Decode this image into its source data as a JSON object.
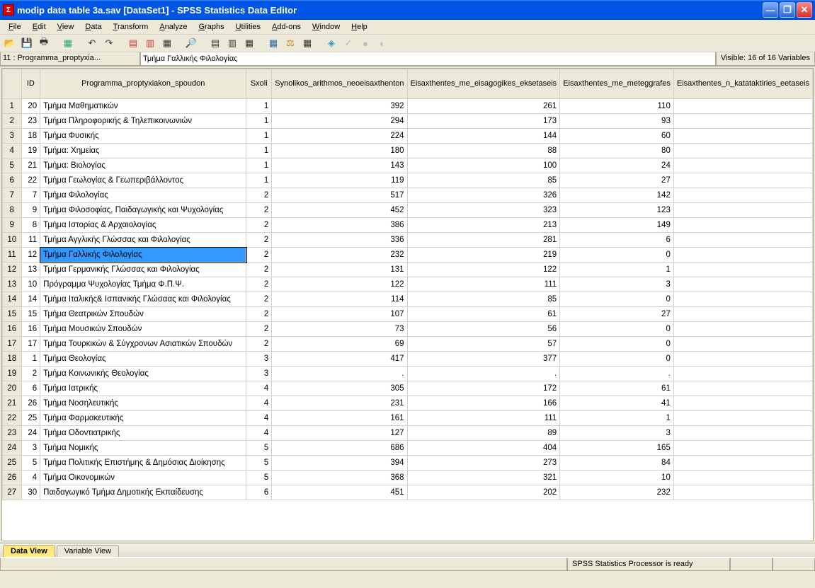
{
  "window": {
    "title": "modip data table 3a.sav [DataSet1] - SPSS Statistics Data Editor"
  },
  "menu": {
    "items": [
      "File",
      "Edit",
      "View",
      "Data",
      "Transform",
      "Analyze",
      "Graphs",
      "Utilities",
      "Add-ons",
      "Window",
      "Help"
    ]
  },
  "infobar": {
    "cellref": "11 : Programma_proptyxia...",
    "cellval": "Τμήμα Γαλλικής Φιλολογίας",
    "visible": "Visible: 16 of 16 Variables"
  },
  "columns": [
    {
      "key": "ID",
      "label": "ID",
      "class": "col-id",
      "align": "num"
    },
    {
      "key": "prog",
      "label": "Programma_proptyxiakon_spoudon",
      "class": "col-prog",
      "align": "txt"
    },
    {
      "key": "sxoli",
      "label": "Sxoli",
      "class": "col-sxoli",
      "align": "num"
    },
    {
      "key": "c1",
      "label": "Synolikos_arithmos_neoeisaxthenton",
      "class": "col-n1",
      "align": "num"
    },
    {
      "key": "c2",
      "label": "Eisaxthentes_me_eisagogikes_eksetaseis",
      "class": "col-n2",
      "align": "num"
    },
    {
      "key": "c3",
      "label": "Eisaxthentes_me_meteggrafes",
      "class": "col-n3",
      "align": "num"
    },
    {
      "key": "c4",
      "label": "Eisaxthentes_n_katataktiries_eetaseis",
      "class": "col-n4",
      "align": "num"
    }
  ],
  "rows": [
    {
      "n": 1,
      "ID": 20,
      "prog": "Τμήμα  Μαθηματικών",
      "sxoli": 1,
      "c1": 392,
      "c2": 261,
      "c3": 110,
      "c4": ""
    },
    {
      "n": 2,
      "ID": 23,
      "prog": "Τμήμα Πληροφορικής & Τηλεπικοινωνιών",
      "sxoli": 1,
      "c1": 294,
      "c2": 173,
      "c3": 93,
      "c4": ""
    },
    {
      "n": 3,
      "ID": 18,
      "prog": "Τμήμα Φυσικής",
      "sxoli": 1,
      "c1": 224,
      "c2": 144,
      "c3": 60,
      "c4": ""
    },
    {
      "n": 4,
      "ID": 19,
      "prog": "Τμήμα: Χημείας",
      "sxoli": 1,
      "c1": 180,
      "c2": 88,
      "c3": 80,
      "c4": ""
    },
    {
      "n": 5,
      "ID": 21,
      "prog": "Τμήμα: Βιολογίας",
      "sxoli": 1,
      "c1": 143,
      "c2": 100,
      "c3": 24,
      "c4": ""
    },
    {
      "n": 6,
      "ID": 22,
      "prog": "Τμήμα  Γεωλογίας  & Γεωπεριβάλλοντος",
      "sxoli": 1,
      "c1": 119,
      "c2": 85,
      "c3": 27,
      "c4": ""
    },
    {
      "n": 7,
      "ID": 7,
      "prog": "Τμήμα  Φιλολογίας",
      "sxoli": 2,
      "c1": 517,
      "c2": 326,
      "c3": 142,
      "c4": ""
    },
    {
      "n": 8,
      "ID": 9,
      "prog": "Τμήμα Φιλοσοφίας, Παιδαγωγικής και Ψυχολογίας",
      "sxoli": 2,
      "c1": 452,
      "c2": 323,
      "c3": 123,
      "c4": ""
    },
    {
      "n": 9,
      "ID": 8,
      "prog": "Τμήμα  Ιστορίας & Αρχαιολογίας",
      "sxoli": 2,
      "c1": 386,
      "c2": 213,
      "c3": 149,
      "c4": ""
    },
    {
      "n": 10,
      "ID": 11,
      "prog": "Τμήμα  Αγγλικής Γλώσσας και Φιλολογίας",
      "sxoli": 2,
      "c1": 336,
      "c2": 281,
      "c3": 6,
      "c4": ""
    },
    {
      "n": 11,
      "ID": 12,
      "prog": "Τμήμα Γαλλικής Φιλολογίας",
      "sxoli": 2,
      "c1": 232,
      "c2": 219,
      "c3": 0,
      "c4": "",
      "selected": true
    },
    {
      "n": 12,
      "ID": 13,
      "prog": "Τμήμα  Γερμανικής Γλώσσας και Φιλολογίας",
      "sxoli": 2,
      "c1": 131,
      "c2": 122,
      "c3": 1,
      "c4": ""
    },
    {
      "n": 13,
      "ID": 10,
      "prog": "Πρόγραμμα Ψυχολογίας Τμήμα Φ.Π.Ψ.",
      "sxoli": 2,
      "c1": 122,
      "c2": 111,
      "c3": 3,
      "c4": ""
    },
    {
      "n": 14,
      "ID": 14,
      "prog": "Τμήμα Ιταλικής& Ισπανικής Γλώσαας και Φιλολογίας",
      "sxoli": 2,
      "c1": 114,
      "c2": 85,
      "c3": 0,
      "c4": ""
    },
    {
      "n": 15,
      "ID": 15,
      "prog": "Τμήμα Θεατρικών Σπουδών",
      "sxoli": 2,
      "c1": 107,
      "c2": 61,
      "c3": 27,
      "c4": ""
    },
    {
      "n": 16,
      "ID": 16,
      "prog": "Τμήμα  Μουσικών Σπουδών",
      "sxoli": 2,
      "c1": 73,
      "c2": 56,
      "c3": 0,
      "c4": ""
    },
    {
      "n": 17,
      "ID": 17,
      "prog": "Τμήμα Τουρκικών & Σύγχρονων Ασιατικών Σπουδών",
      "sxoli": 2,
      "c1": 69,
      "c2": 57,
      "c3": 0,
      "c4": ""
    },
    {
      "n": 18,
      "ID": 1,
      "prog": "Τμήμα Θεολογίας",
      "sxoli": 3,
      "c1": 417,
      "c2": 377,
      "c3": 0,
      "c4": ""
    },
    {
      "n": 19,
      "ID": 2,
      "prog": "Τμήμα Κοινωνικής Θεολογίας",
      "sxoli": 3,
      "c1": ".",
      "c2": ".",
      "c3": ".",
      "c4": ""
    },
    {
      "n": 20,
      "ID": 6,
      "prog": "Τμήμα  Ιατρικής",
      "sxoli": 4,
      "c1": 305,
      "c2": 172,
      "c3": 61,
      "c4": ""
    },
    {
      "n": 21,
      "ID": 26,
      "prog": "Τμήμα Νοσηλευτικής",
      "sxoli": 4,
      "c1": 231,
      "c2": 166,
      "c3": 41,
      "c4": ""
    },
    {
      "n": 22,
      "ID": 25,
      "prog": "Τμήμα Φαρμακευτικής",
      "sxoli": 4,
      "c1": 161,
      "c2": 111,
      "c3": 1,
      "c4": ""
    },
    {
      "n": 23,
      "ID": 24,
      "prog": "Τμήμα Οδοντιατρικής",
      "sxoli": 4,
      "c1": 127,
      "c2": 89,
      "c3": 3,
      "c4": ""
    },
    {
      "n": 24,
      "ID": 3,
      "prog": "Τμήμα Νομικής",
      "sxoli": 5,
      "c1": 686,
      "c2": 404,
      "c3": 165,
      "c4": ""
    },
    {
      "n": 25,
      "ID": 5,
      "prog": "Τμήμα   Πολιτικής Επιστήμης & Δημόσιας Διοίκησης",
      "sxoli": 5,
      "c1": 394,
      "c2": 273,
      "c3": 84,
      "c4": ""
    },
    {
      "n": 26,
      "ID": 4,
      "prog": "Τμήμα Οικονομικών",
      "sxoli": 5,
      "c1": 368,
      "c2": 321,
      "c3": 10,
      "c4": ""
    },
    {
      "n": 27,
      "ID": 30,
      "prog": "Παιδαγωγικό Τμήμα Δημοτικής Εκπαίδευσης",
      "sxoli": 6,
      "c1": 451,
      "c2": 202,
      "c3": 232,
      "c4": ""
    }
  ],
  "tabs": {
    "data_view": "Data View",
    "variable_view": "Variable View"
  },
  "status": {
    "message": "SPSS Statistics Processor is ready"
  }
}
